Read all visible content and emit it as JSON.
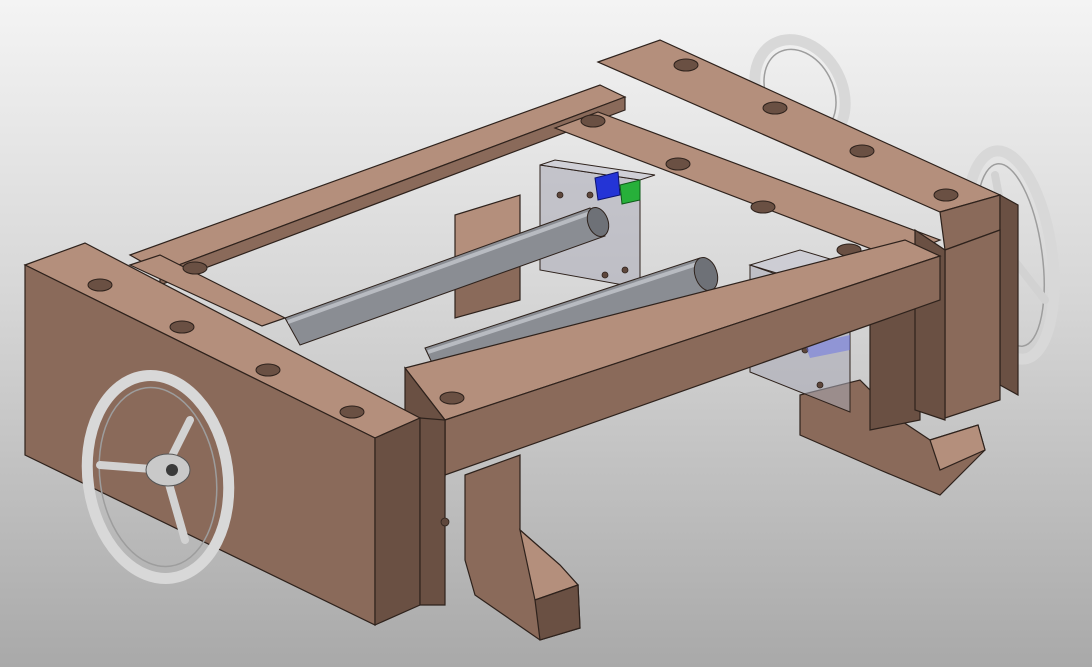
{
  "viewport": {
    "background_top": "#f4f4f4",
    "background_bottom": "#a9a9a9"
  },
  "palette": {
    "wood_top": "#b48f7c",
    "wood_front": "#8a6a5a",
    "wood_side": "#6a5043",
    "wood_dark": "#5e473c",
    "edge": "#2e221c",
    "rod": "#8a8d93",
    "rod_highlight": "#b8bbc1",
    "handwheel": "#d8d8d8",
    "handwheel_shadow": "#9d9d9d",
    "glass_plate": "#a9a9b6",
    "component_blue": "#2434d6",
    "component_green": "#27b03a"
  },
  "model": {
    "icons": [
      "handwheel-icon",
      "guide-rod-icon",
      "carriage-plate-icon",
      "motor-block-icon"
    ]
  }
}
